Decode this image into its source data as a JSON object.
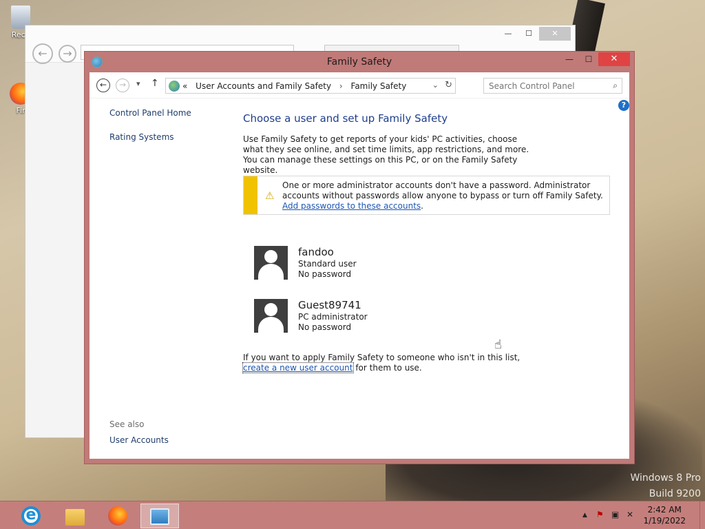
{
  "desktop": {
    "icons": [
      {
        "label": "Recy",
        "icon": "recycle-bin-icon"
      },
      {
        "label": "Fir",
        "icon": "firefox-desktop-icon"
      }
    ],
    "watermark_line1": "Windows 8 Pro",
    "watermark_line2": "Build 9200"
  },
  "window": {
    "title": "Family Safety",
    "minimize": "—",
    "maximize": "☐",
    "close": "✕"
  },
  "nav": {
    "back": "←",
    "forward": "→",
    "recent": "▾",
    "up": "↑",
    "breadcrumb_prefix": "«",
    "breadcrumb": [
      "User Accounts and Family Safety",
      "Family Safety"
    ],
    "breadcrumb_sep": "›",
    "dropdown": "⌄",
    "refresh": "↻"
  },
  "search": {
    "placeholder": "Search Control Panel",
    "icon": "⌕"
  },
  "help": "?",
  "sidebar": {
    "items": [
      {
        "label": "Control Panel Home"
      },
      {
        "label": "Rating Systems"
      }
    ],
    "see_also": "See also",
    "see_also_link": "User Accounts"
  },
  "main": {
    "heading": "Choose a user and set up Family Safety",
    "description": "Use Family Safety to get reports of your kids' PC activities, choose what they see online, and set time limits, app restrictions, and more. You can manage these settings on this PC, or on the Family Safety website.",
    "warning": {
      "icon": "⚠",
      "text": "One or more administrator accounts don't have a password. Administrator accounts without passwords allow anyone to bypass or turn off Family Safety. ",
      "link": "Add passwords to these accounts",
      "end": "."
    },
    "users": [
      {
        "name": "fandoo",
        "role": "Standard user",
        "password": "No password"
      },
      {
        "name": "Guest89741",
        "role": "PC administrator",
        "password": "No password"
      }
    ],
    "footer_before": "If you want to apply Family Safety to someone who isn't in this list, ",
    "footer_link": "create a new user account",
    "footer_after": " for them to use."
  },
  "taskbar": {
    "apps": [
      "ie-icon",
      "file-explorer-icon",
      "firefox-icon",
      "control-panel-icon"
    ],
    "tray": {
      "chevron": "▲",
      "time": "2:42 AM",
      "date": "1/19/2022"
    }
  },
  "colors": {
    "accent": "#c47f7c",
    "warning": "#f1c200",
    "link": "#1e56b4",
    "heading": "#1e3d8c"
  }
}
